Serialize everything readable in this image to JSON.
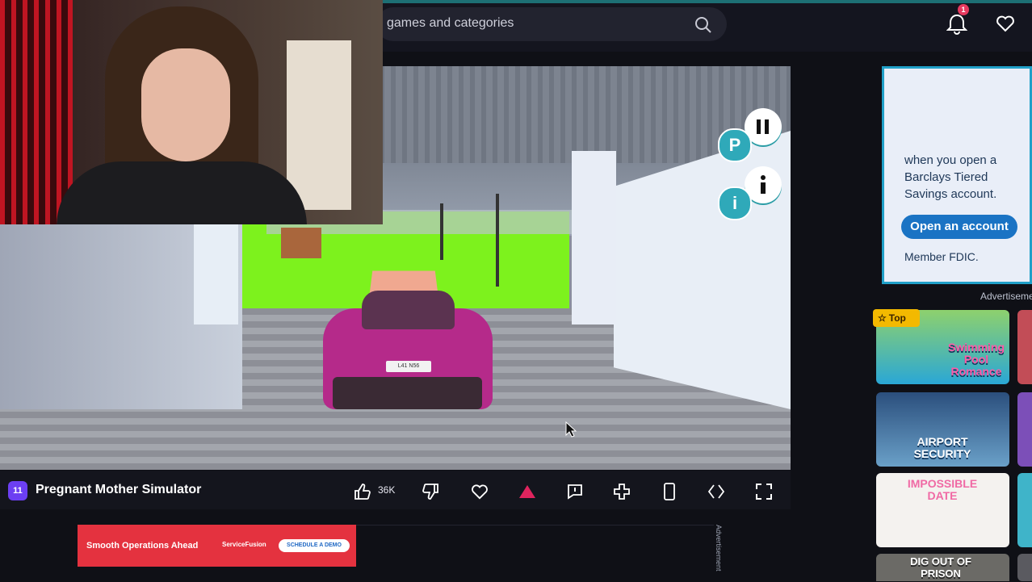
{
  "header": {
    "search_placeholder": "games and categories",
    "notification_count": "1"
  },
  "game": {
    "title": "Pregnant Mother Simulator",
    "logo_text": "11",
    "likes": "36K",
    "plate_text": "L41 N56",
    "buttons": {
      "p_label": "P",
      "i_label": "i"
    }
  },
  "ads": {
    "bottom": {
      "text": "Smooth Operations Ahead",
      "brand": "ServiceFusion",
      "cta": "SCHEDULE A DEMO",
      "vertical_label": "Advertisement"
    },
    "side": {
      "text": "when you open a Barclays Tiered Savings account.",
      "button": "Open an account",
      "footer": "Member FDIC."
    },
    "label": "Advertisement"
  },
  "sidebar": {
    "badge": "Top",
    "games": [
      {
        "title": "Swimming Pool Romance"
      },
      {
        "title": "AIRPORT SECURITY"
      },
      {
        "title": "IMPOSSIBLE DATE"
      },
      {
        "title": "DIG OUT OF PRISON"
      }
    ]
  },
  "colors": {
    "accent": "#6c3ff2",
    "teal": "#2fa9b9",
    "grass": "#7df21d",
    "car": "#b52a8a"
  }
}
